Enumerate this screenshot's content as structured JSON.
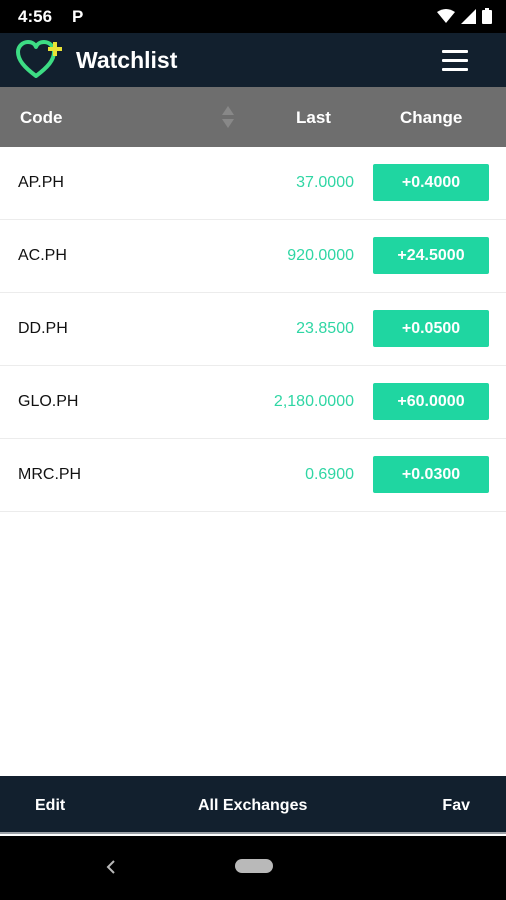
{
  "status_bar": {
    "time": "4:56",
    "app_indicator": "P",
    "icons": [
      "wifi-icon",
      "signal-icon",
      "battery-icon"
    ]
  },
  "app_bar": {
    "title": "Watchlist",
    "logo_icon": "heart-plus-icon",
    "menu_icon": "hamburger-menu-icon"
  },
  "table": {
    "headers": {
      "code": "Code",
      "last": "Last",
      "change": "Change"
    },
    "rows": [
      {
        "code": "AP.PH",
        "last": "37.0000",
        "change": "+0.4000"
      },
      {
        "code": "AC.PH",
        "last": "920.0000",
        "change": "+24.5000"
      },
      {
        "code": "DD.PH",
        "last": "23.8500",
        "change": "+0.0500"
      },
      {
        "code": "GLO.PH",
        "last": "2,180.0000",
        "change": "+60.0000"
      },
      {
        "code": "MRC.PH",
        "last": "0.6900",
        "change": "+0.0300"
      }
    ]
  },
  "bottom_bar": {
    "edit": "Edit",
    "all_exchanges": "All Exchanges",
    "fav": "Fav"
  },
  "colors": {
    "app_bar": "#12202e",
    "header": "#6e6e6e",
    "positive": "#1fd6a1",
    "last_text": "#2fd6a4",
    "logo_green": "#3ddc84",
    "logo_yellow": "#e8e337"
  }
}
